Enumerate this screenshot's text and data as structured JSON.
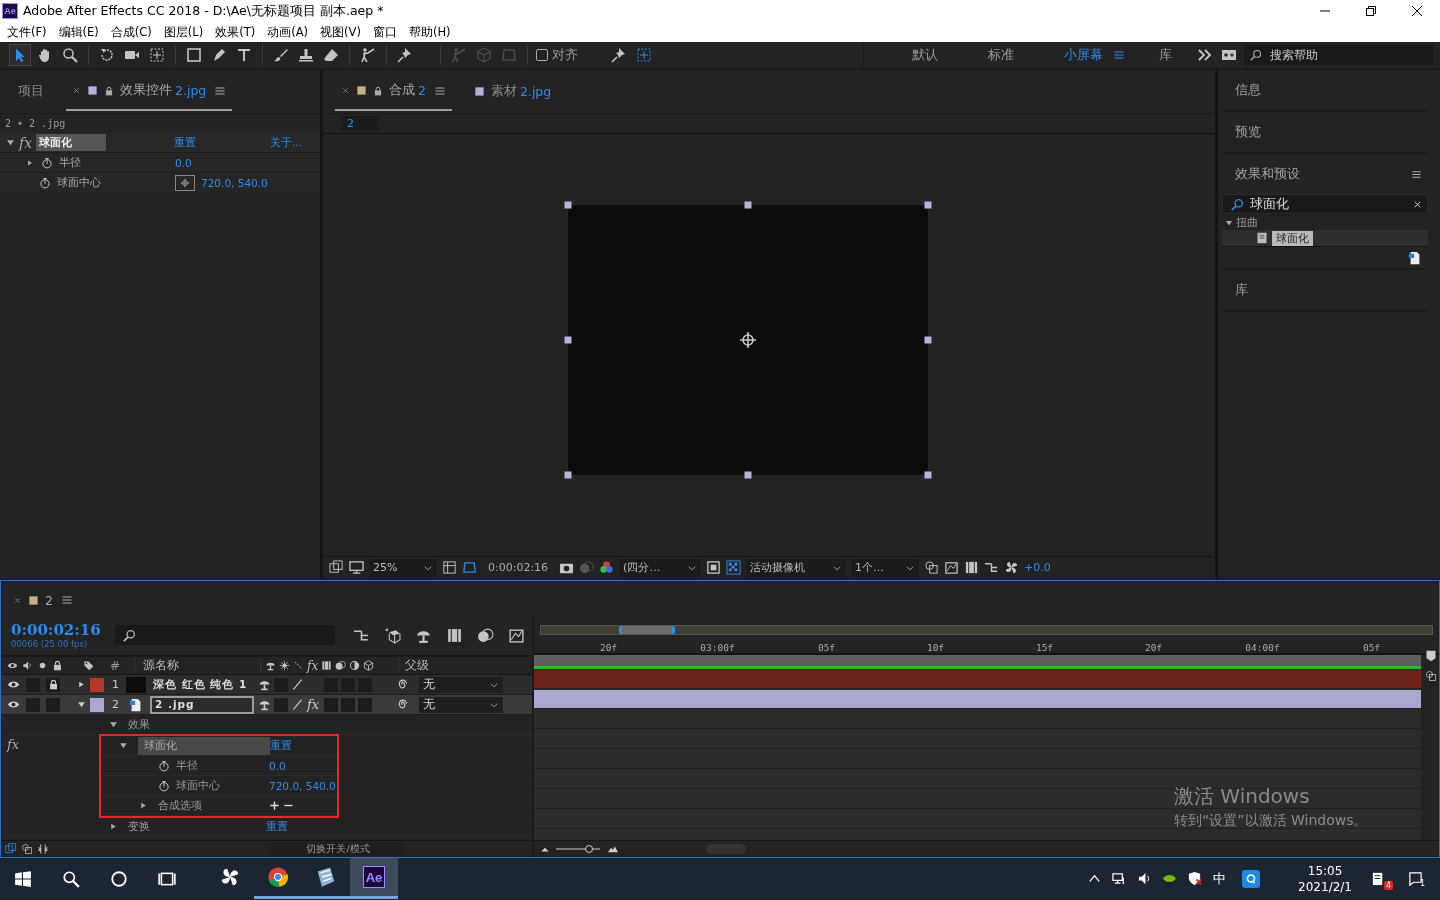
{
  "window": {
    "logo": "Ae",
    "title": "Adobe After Effects CC 2018 - D:\\Ae\\无标题项目 副本.aep *"
  },
  "menu": [
    "文件(F)",
    "编辑(E)",
    "合成(C)",
    "图层(L)",
    "效果(T)",
    "动画(A)",
    "视图(V)",
    "窗口",
    "帮助(H)"
  ],
  "tools": [
    {
      "kind": "select",
      "selected": true
    },
    {
      "kind": "hand",
      "selected": false
    },
    {
      "kind": "zoom",
      "selected": false
    },
    {
      "kind": "rotate",
      "selected": false
    },
    {
      "kind": "camera",
      "selected": false
    },
    {
      "kind": "pan",
      "selected": false
    },
    {
      "kind": "rect",
      "selected": false
    },
    {
      "kind": "pen",
      "selected": false
    },
    {
      "kind": "type",
      "selected": false
    },
    {
      "kind": "brush",
      "selected": false
    },
    {
      "kind": "stamp",
      "selected": false
    },
    {
      "kind": "eraser",
      "selected": false
    },
    {
      "kind": "roto",
      "selected": false
    },
    {
      "kind": "puppet",
      "selected": false
    }
  ],
  "snap": {
    "label": "对齐",
    "checked": false
  },
  "workspaces": [
    {
      "label": "默认",
      "selected": false
    },
    {
      "label": "标准",
      "selected": false
    },
    {
      "label": "小屏幕",
      "selected": true
    },
    {
      "label": "库",
      "selected": false
    }
  ],
  "help_search": {
    "placeholder": "搜索帮助"
  },
  "effect_controls": {
    "tabs": [
      {
        "label": "项目",
        "selected": false
      },
      {
        "label": "效果控件",
        "target": "2.jpg",
        "selected": true
      }
    ],
    "breadcrumb": "2 • 2 .jpg",
    "effect": {
      "mark": "fx",
      "name": "球面化",
      "reset": "重置",
      "about": "关于...",
      "expanded": true,
      "properties": [
        {
          "name": "半径",
          "value": "0.0",
          "kind": "number"
        },
        {
          "name": "球面中心",
          "value": "720.0, 540.0",
          "kind": "point"
        }
      ]
    }
  },
  "viewer": {
    "tabs": [
      {
        "label": "合成",
        "target": "2",
        "selected": true
      },
      {
        "label": "素材",
        "target": "2.jpg",
        "selected": false
      }
    ],
    "breadcrumb": "2",
    "footer": {
      "zoom": "25%",
      "timecode": "0:00:02:16",
      "resolution": "(四分…",
      "camera": "活动摄像机",
      "views": "1个…",
      "exposure": "+0.0"
    }
  },
  "right_panel": {
    "sections": [
      {
        "title": "信息"
      },
      {
        "title": "预览"
      },
      {
        "title": "效果和预设",
        "search": "球面化",
        "tree": [
          {
            "name": "扭曲",
            "expanded": true,
            "children": [
              {
                "name": "球面化",
                "selected": true
              }
            ]
          }
        ]
      },
      {
        "title": "库"
      }
    ]
  },
  "timeline": {
    "tab": "2",
    "timecode": "0:00:02:16",
    "frame_info": "00066 (25.00 fps)",
    "columns": {
      "index": "#",
      "source": "源名称",
      "switch_fx": "fx",
      "parent": "父级"
    },
    "layers": [
      {
        "index": "1",
        "name": "深色 红色 纯色 1",
        "color": "#b5372a",
        "kind": "solid",
        "locked": true,
        "expanded": false,
        "selected": false,
        "parent": "无"
      },
      {
        "index": "2",
        "name": "2 .jpg",
        "color": "#aaa8d0",
        "kind": "image",
        "locked": false,
        "expanded": true,
        "selected": true,
        "effect_switch": "fx",
        "parent": "无"
      }
    ],
    "properties": [
      {
        "name": "效果",
        "expanded": true,
        "children": [
          {
            "name": "球面化",
            "kind": "effect",
            "mark": "fx",
            "reset": "重置",
            "expanded": true,
            "highlight": true,
            "children": [
              {
                "name": "半径",
                "kind": "stopwatch",
                "value": "0.0"
              },
              {
                "name": "球面中心",
                "kind": "stopwatch",
                "value": "720.0, 540.0"
              },
              {
                "name": "合成选项",
                "kind": "options",
                "expanded": false
              }
            ]
          }
        ]
      },
      {
        "name": "变换",
        "expanded": false,
        "reset": "重置"
      }
    ],
    "ruler": [
      "20f",
      "03:00f",
      "05f",
      "10f",
      "15f",
      "20f",
      "04:00f",
      "05f"
    ],
    "mode_toggle": "切换开关/模式",
    "time_zoom": {
      "level": 0.8
    }
  },
  "os_notice": {
    "title": "激活 Windows",
    "text": "转到“设置”以激活 Windows。"
  },
  "taskbar": {
    "apps": [
      {
        "kind": "pinwheel",
        "running": false,
        "active": false
      },
      {
        "kind": "chrome",
        "running": true,
        "active": false
      },
      {
        "kind": "notes",
        "running": true,
        "active": false
      },
      {
        "kind": "ae",
        "label": "Ae",
        "running": true,
        "active": true
      }
    ],
    "ime": "中",
    "time": "15:05",
    "date": "2021/2/1",
    "mail_count": "4",
    "notifications": "1"
  }
}
